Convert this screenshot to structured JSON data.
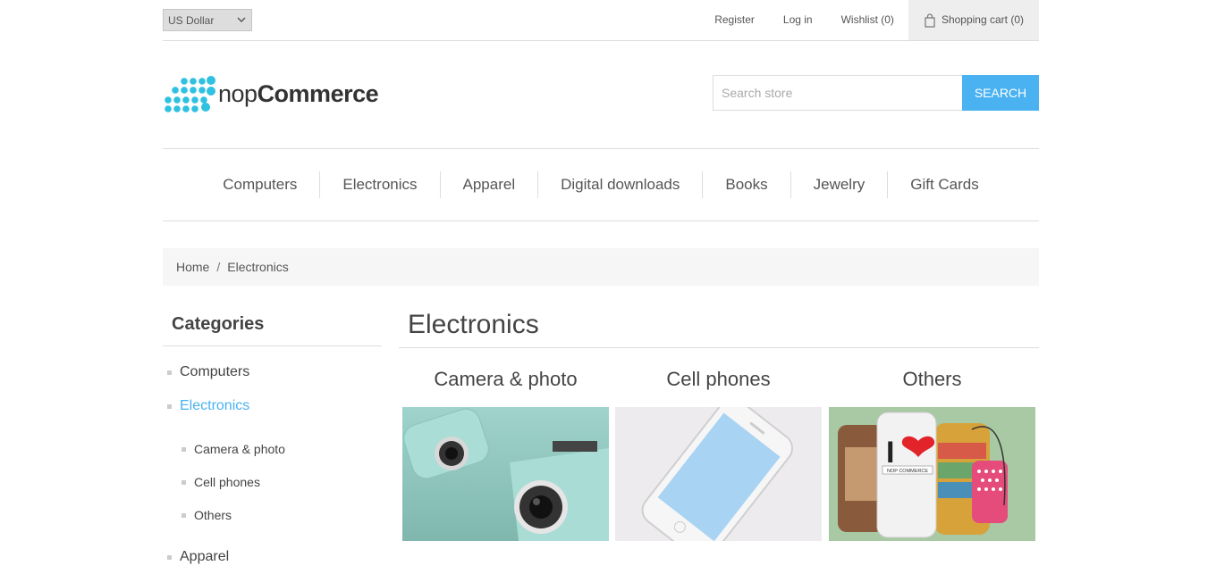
{
  "header": {
    "currency": "US Dollar",
    "register": "Register",
    "login": "Log in",
    "wishlist": "Wishlist (0)",
    "cart": "Shopping cart (0)"
  },
  "logo": {
    "prefix": "nop",
    "bold": "Commerce"
  },
  "search": {
    "placeholder": "Search store",
    "button": "SEARCH"
  },
  "menu": [
    "Computers",
    "Electronics",
    "Apparel",
    "Digital downloads",
    "Books",
    "Jewelry",
    "Gift Cards"
  ],
  "breadcrumb": {
    "home": "Home",
    "separator": "/",
    "current": "Electronics"
  },
  "sidebar": {
    "title": "Categories",
    "items": [
      "Computers",
      "Electronics",
      "Apparel"
    ],
    "subitems": [
      "Camera & photo",
      "Cell phones",
      "Others"
    ]
  },
  "main": {
    "title": "Electronics",
    "subcategories": [
      "Camera & photo",
      "Cell phones",
      "Others"
    ],
    "case_text": "NOP COMMERCE",
    "case_letter": "I"
  },
  "colors": {
    "accent": "#4ab2f1",
    "logo_dots": "#2fc1e1"
  }
}
